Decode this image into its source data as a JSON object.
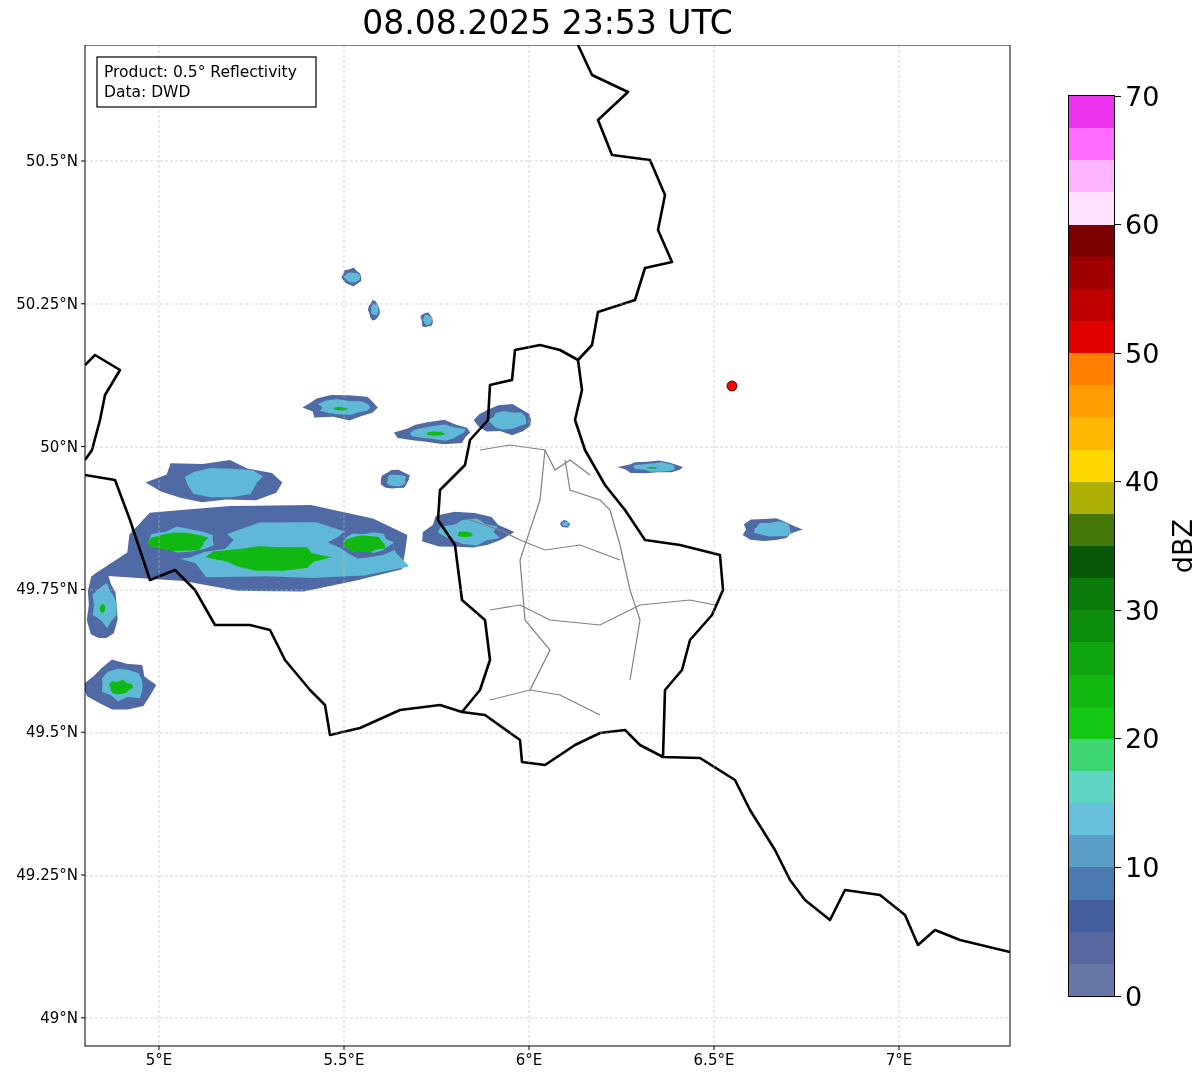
{
  "title": "08.08.2025 23:53 UTC",
  "map": {
    "legend": [
      "Product: 0.5° Reflectivity",
      "Data: DWD"
    ],
    "xticks": [
      "5°E",
      "5.5°E",
      "6°E",
      "6.5°E",
      "7°E"
    ],
    "yticks": [
      "50.5°N",
      "50.25°N",
      "50°N",
      "49.75°N",
      "49.5°N",
      "49.25°N",
      "49°N"
    ]
  },
  "colorbar": {
    "label": "dBZ",
    "ticks": [
      "70",
      "60",
      "50",
      "40",
      "30",
      "20",
      "10",
      "0"
    ],
    "segments": [
      {
        "color": "#6677a8"
      },
      {
        "color": "#56689e"
      },
      {
        "color": "#445e9e"
      },
      {
        "color": "#4a7ab0"
      },
      {
        "color": "#5a9ec8"
      },
      {
        "color": "#66c0dc"
      },
      {
        "color": "#5fd6c4"
      },
      {
        "color": "#3dd672"
      },
      {
        "color": "#12c812"
      },
      {
        "color": "#10b810"
      },
      {
        "color": "#0ea50e"
      },
      {
        "color": "#0c8e0c"
      },
      {
        "color": "#0a7a0a"
      },
      {
        "color": "#085808"
      },
      {
        "color": "#467808"
      },
      {
        "color": "#aeb006"
      },
      {
        "color": "#ffd700"
      },
      {
        "color": "#ffb800"
      },
      {
        "color": "#ff9c00"
      },
      {
        "color": "#ff7f00"
      },
      {
        "color": "#e10000"
      },
      {
        "color": "#c00000"
      },
      {
        "color": "#a00000"
      },
      {
        "color": "#7c0000"
      },
      {
        "color": "#ffe0ff"
      },
      {
        "color": "#ffb4ff"
      },
      {
        "color": "#ff6bff"
      },
      {
        "color": "#ee33ee"
      }
    ]
  }
}
